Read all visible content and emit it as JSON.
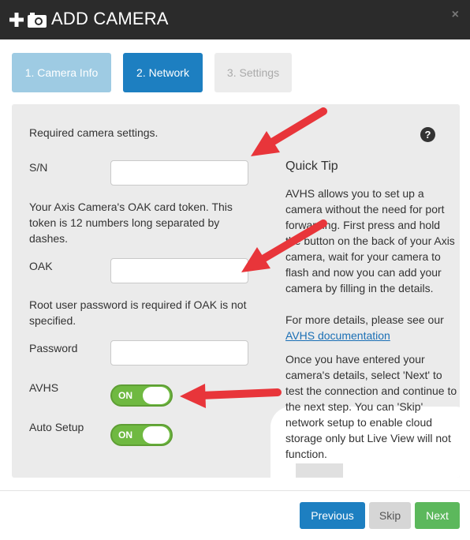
{
  "dialog": {
    "title": "ADD CAMERA",
    "close_glyph": "×"
  },
  "steps": [
    {
      "label": "1. Camera Info",
      "state": "completed"
    },
    {
      "label": "2. Network",
      "state": "active"
    },
    {
      "label": "3. Settings",
      "state": "disabled"
    }
  ],
  "form": {
    "intro": "Required camera settings.",
    "sn": {
      "label": "S/N",
      "value": ""
    },
    "oak_hint": "Your Axis Camera's OAK card token. This token is 12 numbers long separated by dashes.",
    "oak": {
      "label": "OAK",
      "value": ""
    },
    "password_hint": "Root user password is required if OAK is not specified.",
    "password": {
      "label": "Password",
      "value": ""
    },
    "avhs": {
      "label": "AVHS",
      "state": "ON"
    },
    "auto_setup": {
      "label": "Auto Setup",
      "state": "ON"
    }
  },
  "quick_tip": {
    "help_glyph": "?",
    "title": "Quick Tip",
    "para1": "AVHS allows you to set up a camera without the need for port forwarding. First press and hold the button on the back of your Axis camera, wait for your camera to flash and now you can add your camera by filling in the details.",
    "more_prefix": "For more details, please see our",
    "link_text": "AVHS documentation",
    "para2": "Once you have entered your camera's details, select 'Next' to test the connection and continue to the next step. You can 'Skip' network setup to enable cloud storage only but Live View will not function."
  },
  "footer": {
    "previous": "Previous",
    "skip": "Skip",
    "next": "Next"
  },
  "colors": {
    "title_bar": "#2b2b2b",
    "step_active": "#1d7fc1",
    "step_completed": "#9ecbe3",
    "toggle_on": "#6fb941",
    "next_button": "#5cb85c",
    "annotation_arrow": "#e8353a"
  },
  "icons": {
    "title": [
      "plus-icon",
      "camera-icon"
    ],
    "help": "question-circle-icon",
    "annotations": "red-arrow-icon"
  }
}
